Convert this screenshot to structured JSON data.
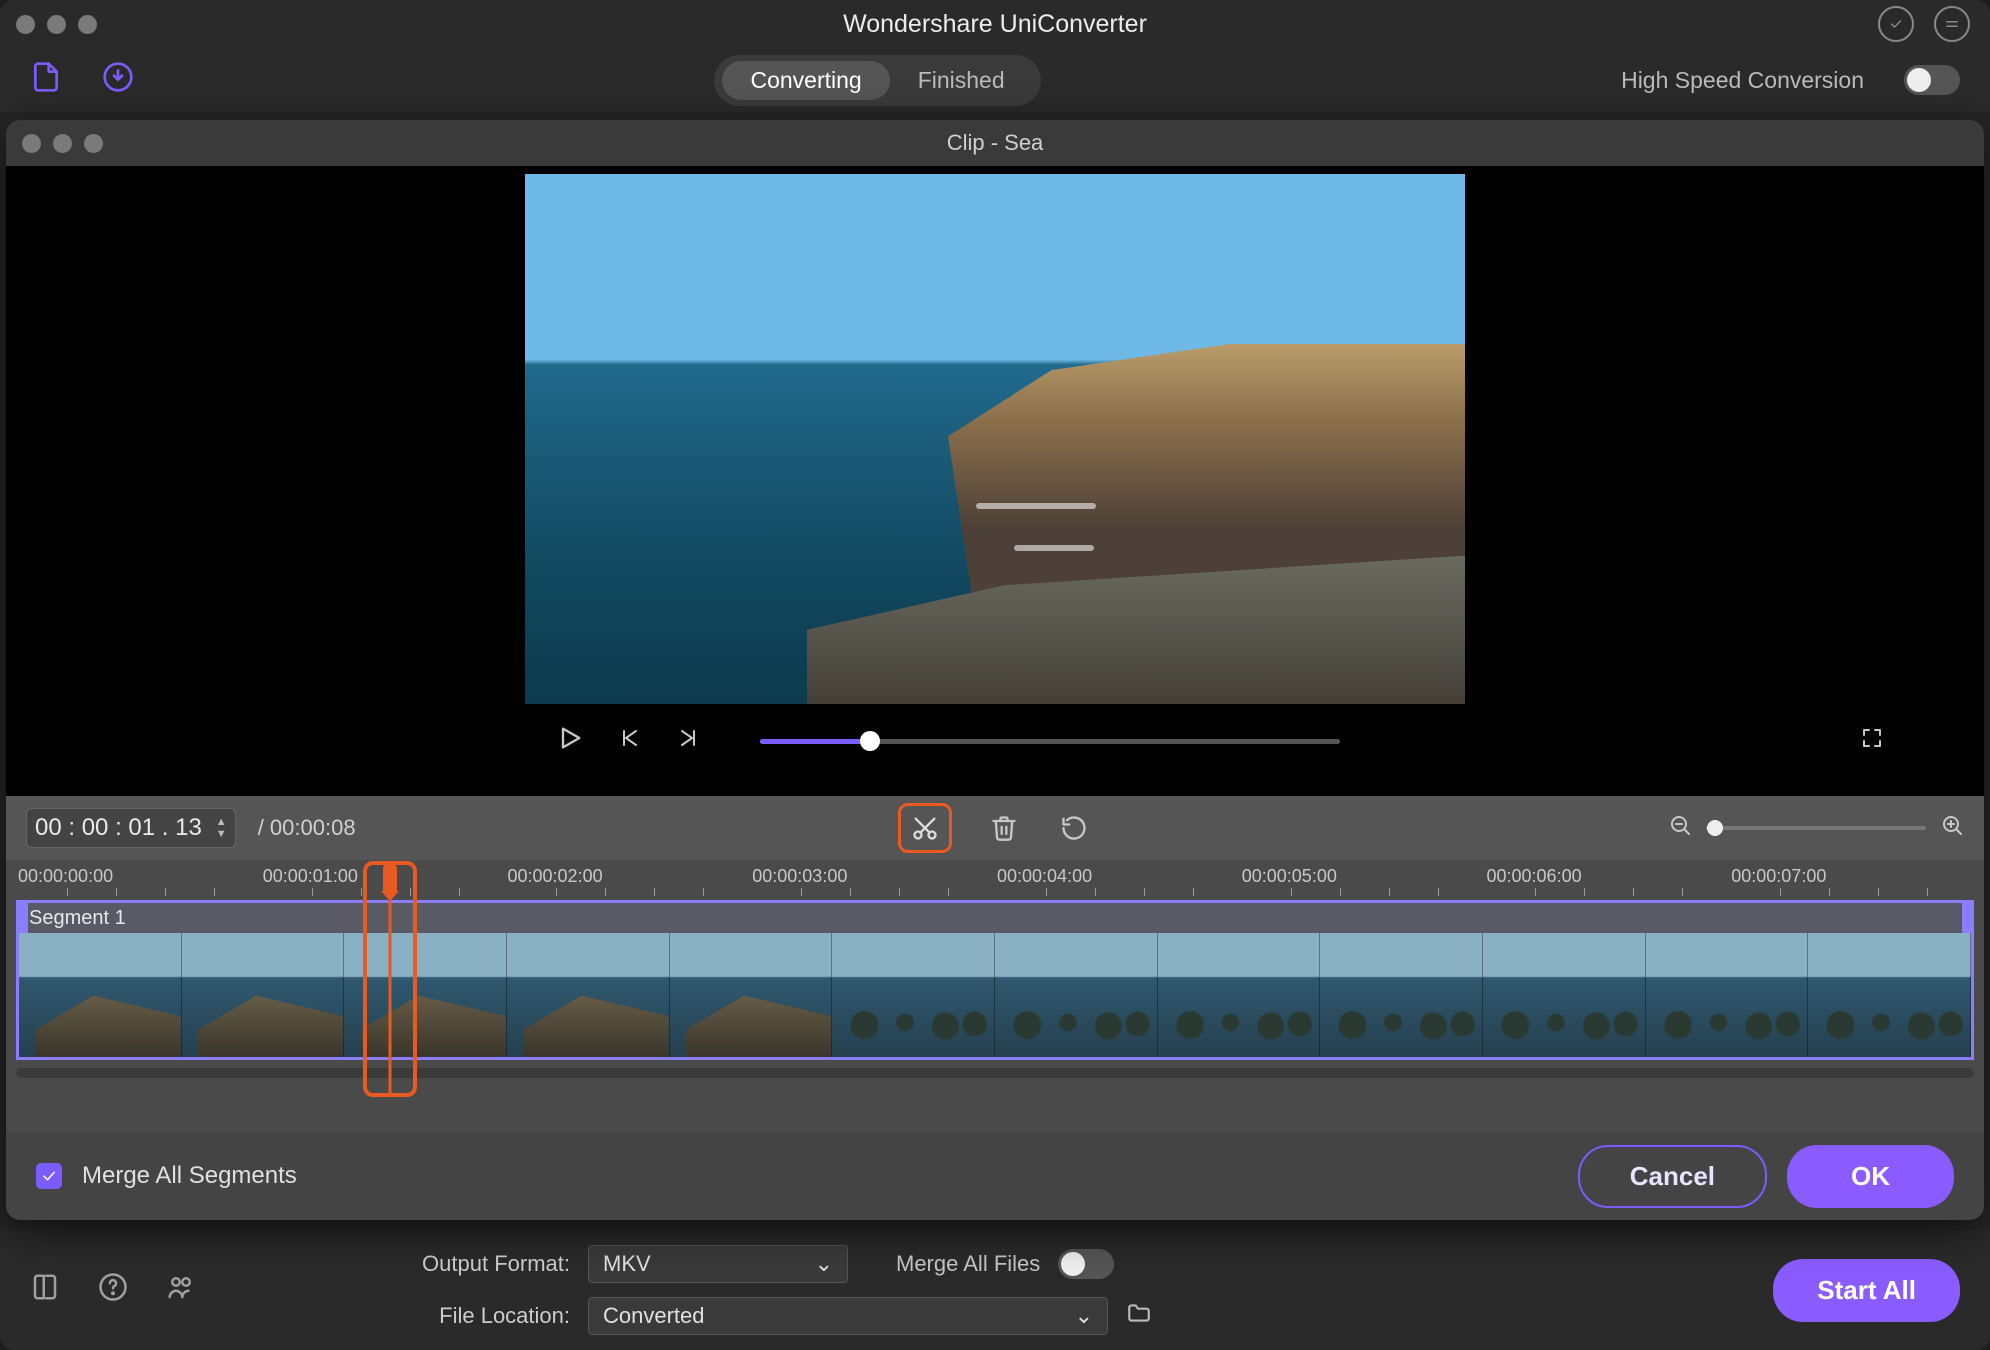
{
  "main": {
    "title": "Wondershare UniConverter",
    "tabs": {
      "converting": "Converting",
      "finished": "Finished"
    },
    "highspeed_label": "High Speed Conversion",
    "output_format_label": "Output Format:",
    "output_format_value": "MKV",
    "file_location_label": "File Location:",
    "file_location_value": "Converted",
    "merge_all_files_label": "Merge All Files",
    "start_all_label": "Start All"
  },
  "clip": {
    "title": "Clip - Sea",
    "current_time": "00 : 00 : 01 . 13",
    "total_time": "/ 00:00:08",
    "segment_label": "Segment 1",
    "ruler_ticks": [
      "00:00:00:00",
      "00:00:01:00",
      "00:00:02:00",
      "00:00:03:00",
      "00:00:04:00",
      "00:00:05:00",
      "00:00:06:00",
      "00:00:07:00"
    ],
    "progress_percent": 19,
    "playhead_percent": 19,
    "merge_segments_label": "Merge All Segments",
    "merge_segments_checked": true,
    "cancel_label": "Cancel",
    "ok_label": "OK",
    "thumb_count": 12
  }
}
